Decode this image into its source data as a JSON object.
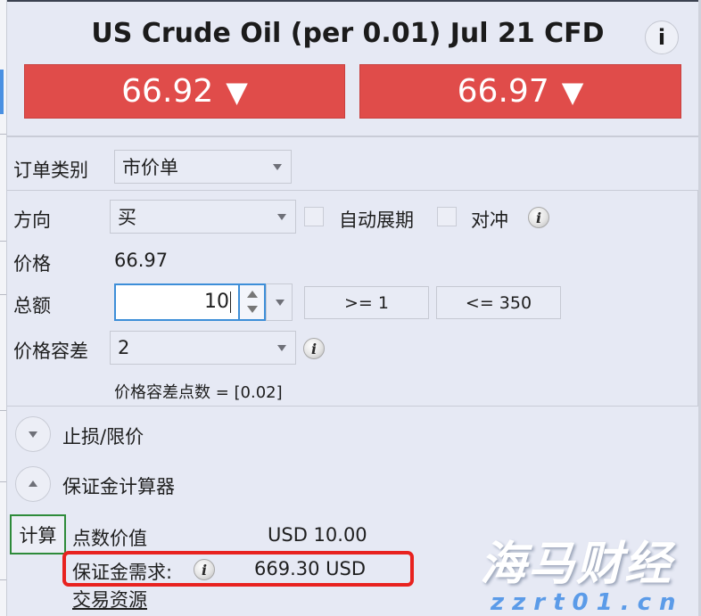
{
  "header": {
    "title": "US Crude Oil (per 0.01) Jul 21 CFD",
    "info_label": "i"
  },
  "prices": {
    "sell": {
      "value": "66.92",
      "arrow": "▼"
    },
    "buy": {
      "value": "66.97",
      "arrow": "▼"
    },
    "color": "#e04c4a"
  },
  "order_type": {
    "label": "订单类别",
    "selected": "市价单"
  },
  "direction": {
    "label": "方向",
    "selected": "买",
    "auto_rollover_label": "自动展期",
    "auto_rollover_checked": false,
    "hedge_label": "对冲",
    "hedge_checked": false
  },
  "price": {
    "label": "价格",
    "value": "66.97"
  },
  "amount": {
    "label": "总额",
    "value": "10",
    "min_label": ">= 1",
    "max_label": "<= 350"
  },
  "tolerance": {
    "label": "价格容差",
    "selected": "2",
    "points_note": "价格容差点数 = [0.02]"
  },
  "sections": {
    "stop_limit": "止损/限价",
    "margin_calculator": "保证金计算器"
  },
  "calculator": {
    "calc_button": "计算",
    "pip_value_label": "点数价值",
    "pip_value": "USD 10.00",
    "margin_label": "保证金需求:",
    "margin_value": "669.30 USD",
    "trading_resources_link": "交易资源"
  },
  "watermark": {
    "brand": "海马财经",
    "url": "zzrt01.cn"
  }
}
